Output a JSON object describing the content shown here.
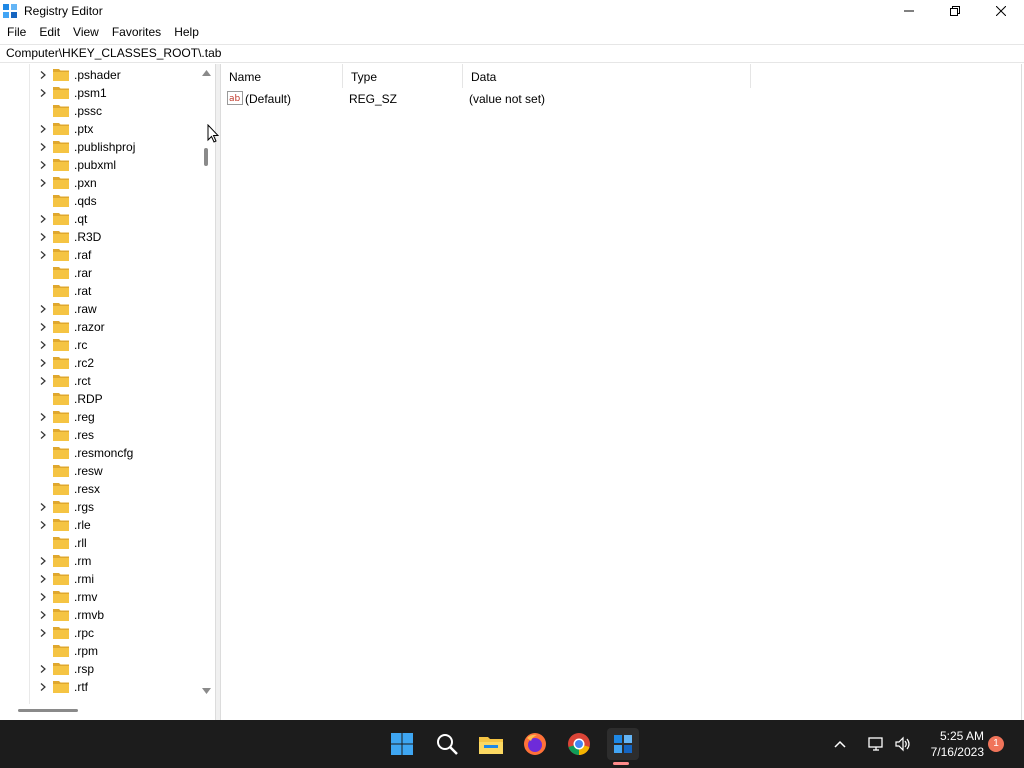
{
  "window": {
    "title": "Registry Editor"
  },
  "menu": [
    "File",
    "Edit",
    "View",
    "Favorites",
    "Help"
  ],
  "address": "Computer\\HKEY_CLASSES_ROOT\\.tab",
  "tree": {
    "items": [
      {
        "label": ".pshader",
        "expandable": true
      },
      {
        "label": ".psm1",
        "expandable": true
      },
      {
        "label": ".pssc",
        "expandable": false
      },
      {
        "label": ".ptx",
        "expandable": true
      },
      {
        "label": ".publishproj",
        "expandable": true
      },
      {
        "label": ".pubxml",
        "expandable": true
      },
      {
        "label": ".pxn",
        "expandable": true
      },
      {
        "label": ".qds",
        "expandable": false
      },
      {
        "label": ".qt",
        "expandable": true
      },
      {
        "label": ".R3D",
        "expandable": true
      },
      {
        "label": ".raf",
        "expandable": true
      },
      {
        "label": ".rar",
        "expandable": false
      },
      {
        "label": ".rat",
        "expandable": false
      },
      {
        "label": ".raw",
        "expandable": true
      },
      {
        "label": ".razor",
        "expandable": true
      },
      {
        "label": ".rc",
        "expandable": true
      },
      {
        "label": ".rc2",
        "expandable": true
      },
      {
        "label": ".rct",
        "expandable": true
      },
      {
        "label": ".RDP",
        "expandable": false
      },
      {
        "label": ".reg",
        "expandable": true
      },
      {
        "label": ".res",
        "expandable": true
      },
      {
        "label": ".resmoncfg",
        "expandable": false
      },
      {
        "label": ".resw",
        "expandable": false
      },
      {
        "label": ".resx",
        "expandable": false
      },
      {
        "label": ".rgs",
        "expandable": true
      },
      {
        "label": ".rle",
        "expandable": true
      },
      {
        "label": ".rll",
        "expandable": false
      },
      {
        "label": ".rm",
        "expandable": true
      },
      {
        "label": ".rmi",
        "expandable": true
      },
      {
        "label": ".rmv",
        "expandable": true
      },
      {
        "label": ".rmvb",
        "expandable": true
      },
      {
        "label": ".rpc",
        "expandable": true
      },
      {
        "label": ".rpm",
        "expandable": false
      },
      {
        "label": ".rsp",
        "expandable": true
      },
      {
        "label": ".rtf",
        "expandable": true
      }
    ]
  },
  "list": {
    "columns": [
      "Name",
      "Type",
      "Data"
    ],
    "rows": [
      {
        "name": "(Default)",
        "type": "REG_SZ",
        "data": "(value not set)"
      }
    ]
  },
  "taskbar": {
    "apps": [
      "start-button",
      "search",
      "file-explorer",
      "firefox",
      "chrome",
      "registry-editor"
    ],
    "time": "5:25 AM",
    "date": "7/16/2023",
    "notification_count": "1"
  },
  "colors": {
    "folder": "#f5c443",
    "taskbar": "#1c1c1c",
    "accent": "#0078d4"
  }
}
